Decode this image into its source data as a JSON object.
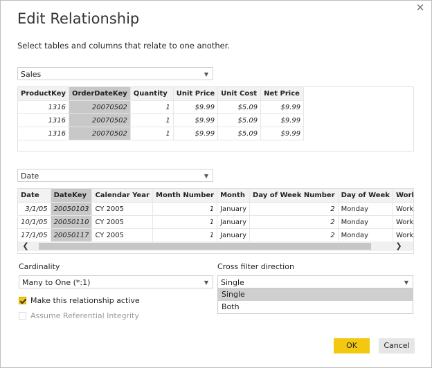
{
  "dialog": {
    "title": "Edit Relationship",
    "subtitle": "Select tables and columns that relate to one another.",
    "close_glyph": "✕"
  },
  "table1": {
    "selected_table": "Sales",
    "columns": [
      "ProductKey",
      "OrderDateKey",
      "Quantity",
      "Unit Price",
      "Unit Cost",
      "Net Price"
    ],
    "selected_column_index": 1,
    "rows": [
      [
        "1316",
        "20070502",
        "1",
        "$9.99",
        "$5.09",
        "$9.99"
      ],
      [
        "1316",
        "20070502",
        "1",
        "$9.99",
        "$5.09",
        "$9.99"
      ],
      [
        "1316",
        "20070502",
        "1",
        "$9.99",
        "$5.09",
        "$9.99"
      ]
    ]
  },
  "table2": {
    "selected_table": "Date",
    "columns": [
      "Date",
      "DateKey",
      "Calendar Year",
      "Month Number",
      "Month",
      "Day of Week Number",
      "Day of Week",
      "Working"
    ],
    "selected_column_index": 1,
    "rows": [
      [
        "3/1/05",
        "20050103",
        "CY 2005",
        "1",
        "January",
        "2",
        "Monday",
        "WorkDay"
      ],
      [
        "10/1/05",
        "20050110",
        "CY 2005",
        "1",
        "January",
        "2",
        "Monday",
        "WorkDay"
      ],
      [
        "17/1/05",
        "20050117",
        "CY 2005",
        "1",
        "January",
        "2",
        "Monday",
        "WorkDay"
      ]
    ],
    "scroll_left": "❮",
    "scroll_right": "❯"
  },
  "cardinality": {
    "label": "Cardinality",
    "value": "Many to One (*:1)"
  },
  "cross_filter": {
    "label": "Cross filter direction",
    "value": "Single",
    "options": [
      "Single",
      "Both"
    ],
    "highlighted_option": "Single"
  },
  "options": {
    "active_label": "Make this relationship active",
    "active_checked": true,
    "referential_label": "Assume Referential Integrity",
    "referential_checked": false
  },
  "buttons": {
    "ok": "OK",
    "cancel": "Cancel"
  },
  "colors": {
    "accent": "#f2c811",
    "selected_column": "#c8c8c8",
    "header_bg": "#f2f2f2"
  }
}
